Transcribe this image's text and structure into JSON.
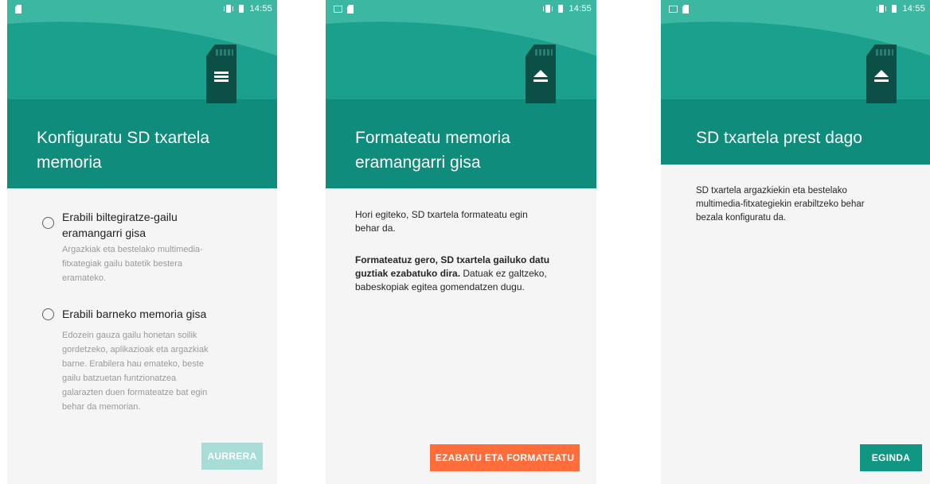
{
  "status_time": "14:55",
  "colors": {
    "header_teal": "#0f8c7b",
    "card_dark": "#0c4f47",
    "accent_orange": "#ff6d3a",
    "button_teal": "#129684",
    "button_disabled": "#a8dcd6"
  },
  "screens": [
    {
      "title_line1": "Konfiguratu SD txartela",
      "title_line2": "memoria",
      "icon": "sd-card-list-icon",
      "options": [
        {
          "label_line1": "Erabili biltegiratze-gailu",
          "label_line2": "eramangarri gisa",
          "desc_lines": [
            "Argazkiak eta bestelako multimedia-",
            "fitxategiak gailu batetik bestera",
            "eramateko."
          ],
          "selected": false
        },
        {
          "label_line1": "Erabili barneko memoria gisa",
          "label_line2": "",
          "desc_lines": [
            "Edozein gauza gailu honetan soilik",
            "gordetzeko, aplikazioak eta argazkiak",
            "barne. Erabilera hau emateko, beste",
            "gailu batzuetan funtzionatzea",
            "galarazten duen formateatze bat egin",
            "behar da memorian."
          ],
          "selected": false
        }
      ],
      "button": "AURRERA"
    },
    {
      "title_line1": "Formateatu memoria",
      "title_line2": "eramangarri gisa",
      "icon": "sd-card-eject-icon",
      "para1_lines": [
        "Hori egiteko, SD txartela formateatu egin",
        "behar da."
      ],
      "para2_bold_line1": "Formateatuz gero, SD txartela gailuko datu",
      "para2_bold_line2": "guztiak ezabatuko dira.",
      "para2_rest_line2": " Datuak ez galtzeko,",
      "para2_line3": "babeskopiak egitea gomendatzen dugu.",
      "button": "EZABATU ETA FORMATEATU"
    },
    {
      "title_line1": "SD txartela prest dago",
      "icon": "sd-card-eject-icon",
      "para_lines": [
        "SD txartela argazkiekin eta bestelako",
        "multimedia-fitxategiekin erabiltzeko behar",
        "bezala konfiguratu da."
      ],
      "button": "EGINDA"
    }
  ]
}
